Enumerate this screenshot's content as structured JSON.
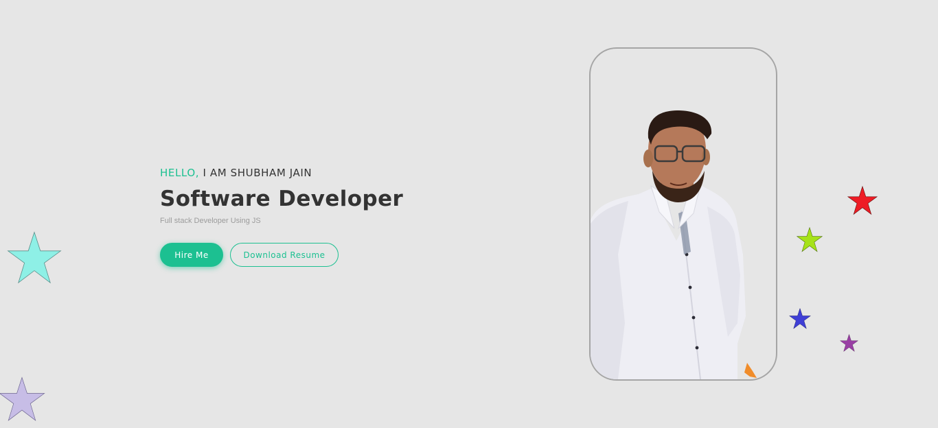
{
  "hero": {
    "greeting_accent": "HELLO,",
    "greeting_rest": " I AM SHUBHAM JAIN",
    "title": "Software Developer",
    "subtitle": "Full stack Developer Using JS",
    "hire_button_label": "Hire Me",
    "resume_button_label": "Download Resume"
  },
  "colors": {
    "accent": "#1cc091",
    "background": "#e6e6e6",
    "heading": "#333333",
    "muted": "#9b9b9b"
  },
  "portrait": {
    "icon": "profile-photo"
  },
  "decorations": {
    "stars": [
      {
        "name": "star-cyan",
        "color": "#8ef0e6"
      },
      {
        "name": "star-lavender",
        "color": "#c7bde6"
      },
      {
        "name": "star-red",
        "color": "#ee1c25"
      },
      {
        "name": "star-lime",
        "color": "#a6e219"
      },
      {
        "name": "star-blue",
        "color": "#3f3fd6"
      },
      {
        "name": "star-purple",
        "color": "#993fa4"
      },
      {
        "name": "star-orange",
        "color": "#f08c2a"
      }
    ]
  }
}
